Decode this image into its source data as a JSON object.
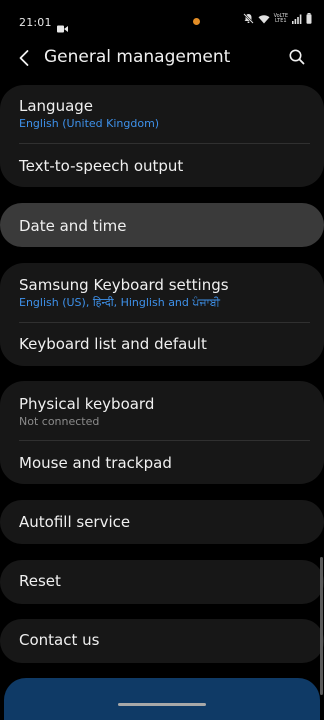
{
  "status_bar": {
    "time": "21:01",
    "network_label_top": "VoLTE",
    "network_label_bottom": "LTE1",
    "icons": [
      "video-icon",
      "mute-icon",
      "wifi-icon",
      "signal-icon",
      "battery-icon"
    ],
    "notification_dot_color": "#e38d26"
  },
  "header": {
    "title": "General management",
    "back_icon": "back-arrow-icon",
    "search_icon": "search-icon"
  },
  "groups": [
    {
      "items": [
        {
          "title": "Language",
          "subtitle": "English (United Kingdom)"
        },
        {
          "title": "Text-to-speech output"
        }
      ]
    },
    {
      "items": [
        {
          "title": "Date and time",
          "highlighted": true
        }
      ]
    },
    {
      "items": [
        {
          "title": "Samsung Keyboard settings",
          "subtitle": "English (US), हिन्दी, Hinglish and ਪੰਜਾਬੀ"
        },
        {
          "title": "Keyboard list and default"
        }
      ]
    },
    {
      "items": [
        {
          "title": "Physical keyboard",
          "subtitle": "Not connected"
        },
        {
          "title": "Mouse and trackpad"
        }
      ]
    },
    {
      "items": [
        {
          "title": "Autofill service"
        }
      ]
    },
    {
      "items": [
        {
          "title": "Reset"
        }
      ]
    },
    {
      "items": [
        {
          "title": "Contact us"
        }
      ]
    }
  ],
  "colors": {
    "background": "#000000",
    "card": "#171717",
    "card_highlighted": "#3a3a3a",
    "subtitle_blue": "#3e91ea",
    "subtitle_grey": "#8b8b8b",
    "bottom_accent": "#0f3a66"
  }
}
